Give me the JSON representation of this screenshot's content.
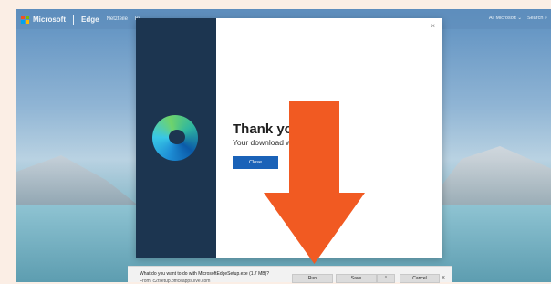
{
  "nav": {
    "brand": "Microsoft",
    "product": "Edge",
    "links": [
      "Netzteile",
      "Br"
    ],
    "right_links": [
      "All Microsoft ⌄",
      "Search ⌕"
    ]
  },
  "modal": {
    "close_glyph": "×",
    "heading": "Thank you",
    "text": "Your download w",
    "close_button": "Close"
  },
  "download_bar": {
    "question": "What do you want to do with MicrosoftEdgeSetup.exe (1.7 MB)?",
    "from": "From: c2rsetup.officeapps.live.com",
    "run": "Run",
    "save": "Save",
    "save_more": "⌃",
    "cancel": "Cancel",
    "close": "×"
  },
  "colors": {
    "arrow": "#f15a22",
    "modal_sidebar": "#1c3550",
    "primary_button": "#1a62b8",
    "page_margin": "#fbeee5"
  },
  "icons": {
    "logo": "microsoft-logo-icon",
    "edge": "edge-logo-icon",
    "arrow": "down-arrow-icon"
  }
}
